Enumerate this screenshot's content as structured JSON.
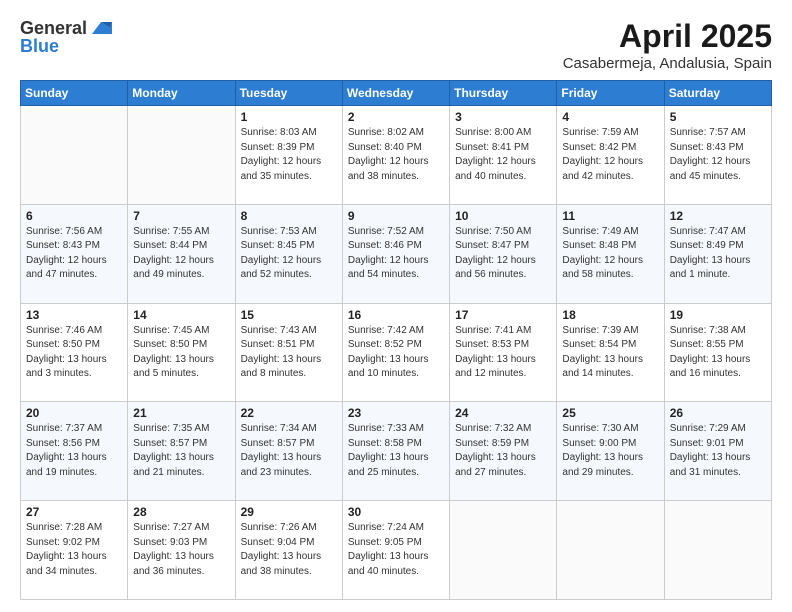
{
  "header": {
    "logo_line1": "General",
    "logo_line2": "Blue",
    "title": "April 2025",
    "subtitle": "Casabermeja, Andalusia, Spain"
  },
  "weekdays": [
    "Sunday",
    "Monday",
    "Tuesday",
    "Wednesday",
    "Thursday",
    "Friday",
    "Saturday"
  ],
  "weeks": [
    [
      {
        "day": "",
        "info": ""
      },
      {
        "day": "",
        "info": ""
      },
      {
        "day": "1",
        "info": "Sunrise: 8:03 AM\nSunset: 8:39 PM\nDaylight: 12 hours and 35 minutes."
      },
      {
        "day": "2",
        "info": "Sunrise: 8:02 AM\nSunset: 8:40 PM\nDaylight: 12 hours and 38 minutes."
      },
      {
        "day": "3",
        "info": "Sunrise: 8:00 AM\nSunset: 8:41 PM\nDaylight: 12 hours and 40 minutes."
      },
      {
        "day": "4",
        "info": "Sunrise: 7:59 AM\nSunset: 8:42 PM\nDaylight: 12 hours and 42 minutes."
      },
      {
        "day": "5",
        "info": "Sunrise: 7:57 AM\nSunset: 8:43 PM\nDaylight: 12 hours and 45 minutes."
      }
    ],
    [
      {
        "day": "6",
        "info": "Sunrise: 7:56 AM\nSunset: 8:43 PM\nDaylight: 12 hours and 47 minutes."
      },
      {
        "day": "7",
        "info": "Sunrise: 7:55 AM\nSunset: 8:44 PM\nDaylight: 12 hours and 49 minutes."
      },
      {
        "day": "8",
        "info": "Sunrise: 7:53 AM\nSunset: 8:45 PM\nDaylight: 12 hours and 52 minutes."
      },
      {
        "day": "9",
        "info": "Sunrise: 7:52 AM\nSunset: 8:46 PM\nDaylight: 12 hours and 54 minutes."
      },
      {
        "day": "10",
        "info": "Sunrise: 7:50 AM\nSunset: 8:47 PM\nDaylight: 12 hours and 56 minutes."
      },
      {
        "day": "11",
        "info": "Sunrise: 7:49 AM\nSunset: 8:48 PM\nDaylight: 12 hours and 58 minutes."
      },
      {
        "day": "12",
        "info": "Sunrise: 7:47 AM\nSunset: 8:49 PM\nDaylight: 13 hours and 1 minute."
      }
    ],
    [
      {
        "day": "13",
        "info": "Sunrise: 7:46 AM\nSunset: 8:50 PM\nDaylight: 13 hours and 3 minutes."
      },
      {
        "day": "14",
        "info": "Sunrise: 7:45 AM\nSunset: 8:50 PM\nDaylight: 13 hours and 5 minutes."
      },
      {
        "day": "15",
        "info": "Sunrise: 7:43 AM\nSunset: 8:51 PM\nDaylight: 13 hours and 8 minutes."
      },
      {
        "day": "16",
        "info": "Sunrise: 7:42 AM\nSunset: 8:52 PM\nDaylight: 13 hours and 10 minutes."
      },
      {
        "day": "17",
        "info": "Sunrise: 7:41 AM\nSunset: 8:53 PM\nDaylight: 13 hours and 12 minutes."
      },
      {
        "day": "18",
        "info": "Sunrise: 7:39 AM\nSunset: 8:54 PM\nDaylight: 13 hours and 14 minutes."
      },
      {
        "day": "19",
        "info": "Sunrise: 7:38 AM\nSunset: 8:55 PM\nDaylight: 13 hours and 16 minutes."
      }
    ],
    [
      {
        "day": "20",
        "info": "Sunrise: 7:37 AM\nSunset: 8:56 PM\nDaylight: 13 hours and 19 minutes."
      },
      {
        "day": "21",
        "info": "Sunrise: 7:35 AM\nSunset: 8:57 PM\nDaylight: 13 hours and 21 minutes."
      },
      {
        "day": "22",
        "info": "Sunrise: 7:34 AM\nSunset: 8:57 PM\nDaylight: 13 hours and 23 minutes."
      },
      {
        "day": "23",
        "info": "Sunrise: 7:33 AM\nSunset: 8:58 PM\nDaylight: 13 hours and 25 minutes."
      },
      {
        "day": "24",
        "info": "Sunrise: 7:32 AM\nSunset: 8:59 PM\nDaylight: 13 hours and 27 minutes."
      },
      {
        "day": "25",
        "info": "Sunrise: 7:30 AM\nSunset: 9:00 PM\nDaylight: 13 hours and 29 minutes."
      },
      {
        "day": "26",
        "info": "Sunrise: 7:29 AM\nSunset: 9:01 PM\nDaylight: 13 hours and 31 minutes."
      }
    ],
    [
      {
        "day": "27",
        "info": "Sunrise: 7:28 AM\nSunset: 9:02 PM\nDaylight: 13 hours and 34 minutes."
      },
      {
        "day": "28",
        "info": "Sunrise: 7:27 AM\nSunset: 9:03 PM\nDaylight: 13 hours and 36 minutes."
      },
      {
        "day": "29",
        "info": "Sunrise: 7:26 AM\nSunset: 9:04 PM\nDaylight: 13 hours and 38 minutes."
      },
      {
        "day": "30",
        "info": "Sunrise: 7:24 AM\nSunset: 9:05 PM\nDaylight: 13 hours and 40 minutes."
      },
      {
        "day": "",
        "info": ""
      },
      {
        "day": "",
        "info": ""
      },
      {
        "day": "",
        "info": ""
      }
    ]
  ]
}
